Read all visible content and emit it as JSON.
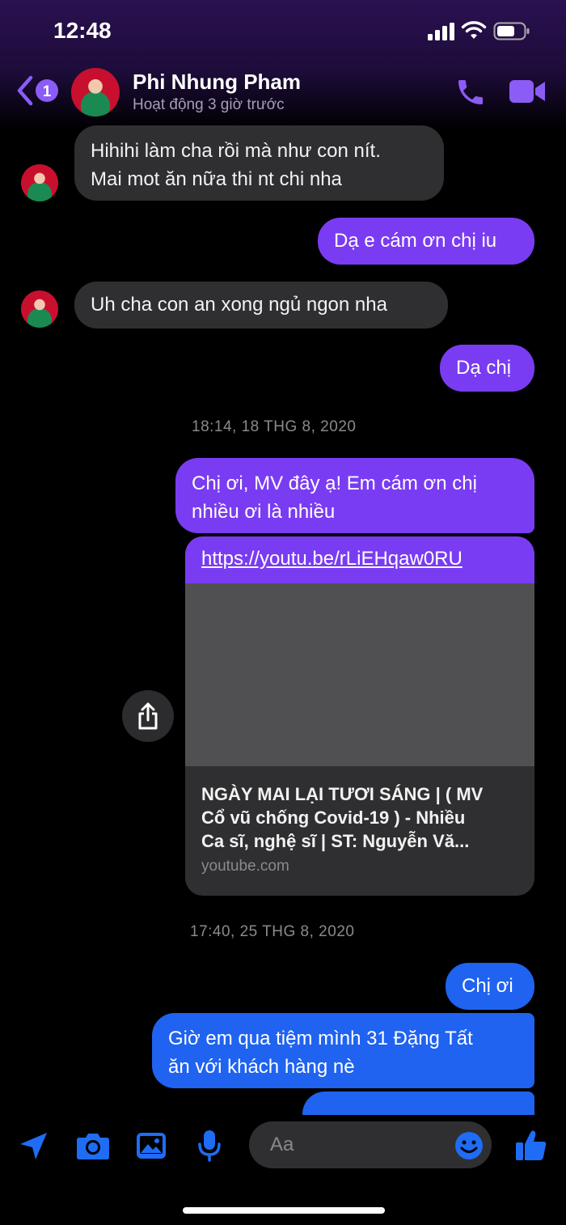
{
  "status_bar": {
    "time": "12:48"
  },
  "header": {
    "unread_count": "1",
    "contact_name": "Phi Nhung Pham",
    "contact_status": "Hoạt động 3 giờ trước"
  },
  "messages": [
    {
      "from": "contact",
      "lines": [
        "Hihihi làm cha rồi mà như con nít.",
        "Mai mot ăn nữa thi nt chi nha"
      ]
    },
    {
      "from": "me",
      "lines": [
        "Dạ e cám ơn chị iu"
      ]
    },
    {
      "from": "contact",
      "lines": [
        "Uh cha con an xong ngủ ngon nha"
      ]
    },
    {
      "from": "me",
      "lines": [
        "Dạ chị"
      ]
    },
    {
      "timestamp": "18:14, 18 THG 8, 2020"
    },
    {
      "from": "me",
      "lines": [
        "Chị ơi, MV đây ạ! Em cám ơn chị",
        "nhiều ơi là nhiều"
      ]
    },
    {
      "from": "me",
      "link_card": {
        "url": "https://youtu.be/rLiEHqaw0RU",
        "title_lines": [
          "NGÀY MAI LẠI TƯƠI SÁNG | ( MV",
          "Cổ vũ chống Covid-19 ) - Nhiều",
          "Ca sĩ, nghệ sĩ | ST: Nguyễn Vă..."
        ],
        "domain": "youtube.com"
      }
    },
    {
      "timestamp": "17:40, 25 THG 8, 2020"
    },
    {
      "from": "me",
      "lines": [
        "Chị ơi"
      ]
    },
    {
      "from": "me",
      "lines": [
        "Giờ em qua tiệm mình 31 Đặng Tất",
        "ăn với khách hàng nè"
      ]
    }
  ],
  "composer": {
    "placeholder": "Aa"
  },
  "colors": {
    "accent_purple": "#7a3cf2",
    "accent_blue": "#1f63f0",
    "incoming_bubble": "#2f2f31"
  },
  "icons": [
    "signal-icon",
    "wifi-icon",
    "battery-icon",
    "back-chevron-icon",
    "phone-icon",
    "video-icon",
    "share-icon",
    "location-arrow-icon",
    "camera-icon",
    "gallery-icon",
    "microphone-icon",
    "emoji-icon",
    "thumbs-up-icon"
  ]
}
